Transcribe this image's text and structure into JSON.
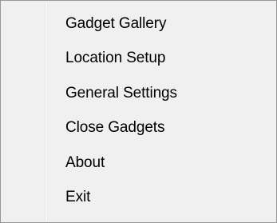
{
  "context_menu": {
    "items": [
      {
        "label": "Gadget Gallery"
      },
      {
        "label": "Location Setup"
      },
      {
        "label": "General Settings"
      },
      {
        "label": "Close Gadgets"
      },
      {
        "label": "About"
      },
      {
        "label": "Exit"
      }
    ]
  },
  "colors": {
    "menu_background": "#f0f0f0",
    "menu_border": "#979797",
    "gutter_separator": "#e2e3e3",
    "text": "#000000"
  }
}
